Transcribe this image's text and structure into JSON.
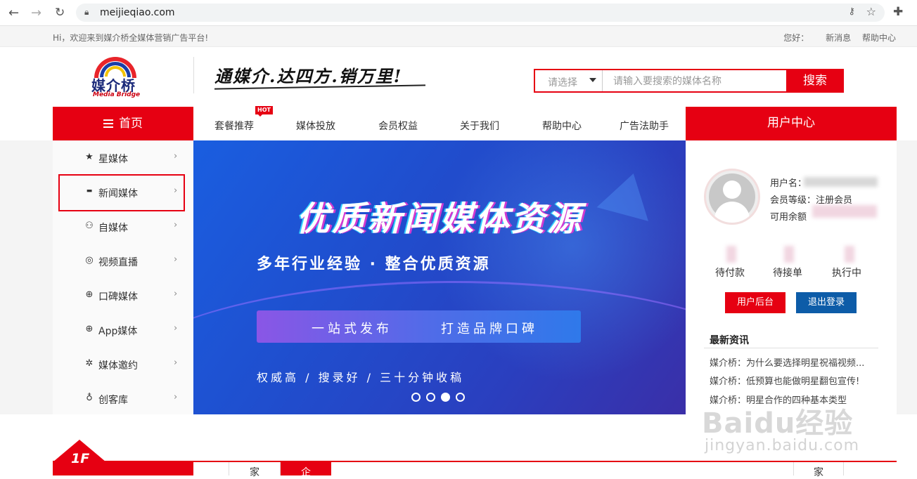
{
  "browser": {
    "url": "meijieqiao.com",
    "back_icon": "arrow-left",
    "forward_icon": "arrow-right",
    "reload_icon": "reload",
    "lock_icon": "lock",
    "key_icon": "key",
    "star_icon": "star",
    "extensions_icon": "puzzle"
  },
  "topbar": {
    "welcome": "Hi，欢迎来到媒介桥全媒体营销广告平台!",
    "greeting": "您好：",
    "news": "新消息",
    "help": "帮助中心"
  },
  "header": {
    "logo_name": "媒介桥",
    "logo_sub": "Media Bridge",
    "slogan": "通媒介.达四方.销万里!",
    "search_select": "请选择",
    "search_placeholder": "请输入要搜索的媒体名称",
    "search_button": "搜索"
  },
  "nav": {
    "home": "首页",
    "hot_badge": "HOT",
    "items": [
      "套餐推荐",
      "媒体投放",
      "会员权益",
      "关于我们",
      "帮助中心",
      "广告法助手"
    ],
    "user_center": "用户中心"
  },
  "sidebar": {
    "items": [
      {
        "label": "星媒体",
        "icon": "star-icon"
      },
      {
        "label": "新闻媒体",
        "icon": "news-icon"
      },
      {
        "label": "自媒体",
        "icon": "wechat-icon"
      },
      {
        "label": "视频直播",
        "icon": "video-icon"
      },
      {
        "label": "口碑媒体",
        "icon": "globe-icon"
      },
      {
        "label": "App媒体",
        "icon": "app-icon"
      },
      {
        "label": "媒体邀约",
        "icon": "invite-icon"
      },
      {
        "label": "创客库",
        "icon": "mic-icon"
      }
    ],
    "arrow": "›"
  },
  "banner": {
    "title": "优质新闻媒体资源",
    "subtitle": "多年行业经验 · 整合优质资源",
    "pill_left": "一站式发布",
    "pill_right": "打造品牌口碑",
    "tags": "权威高 / 搜录好 / 三十分钟收稿",
    "slide_count": 4,
    "active_slide": 3
  },
  "user_panel": {
    "username_label": "用户名：",
    "level_label": "会员等级：",
    "level_value": "注册会员",
    "balance_label": "可用余额",
    "stats": [
      "待付款",
      "待接单",
      "执行中"
    ],
    "backend_button": "用户后台",
    "logout_button": "退出登录",
    "news_title": "最新资讯",
    "news": [
      "媒介桥：为什么要选择明星祝福视频...",
      "媒介桥：低预算也能做明星翻包宣传!",
      "媒介桥：明星合作的四种基本类型"
    ],
    "colors": {
      "backend": "#e60012",
      "logout": "#0d5ca8"
    }
  },
  "floor": {
    "label": "1F",
    "tabs": [
      "家",
      "企",
      "家"
    ]
  },
  "watermark": {
    "line1": "Baidu经验",
    "line2": "jingyan.baidu.com"
  },
  "colors": {
    "brand_red": "#e60012",
    "banner_blue": "#1f4fcf"
  }
}
